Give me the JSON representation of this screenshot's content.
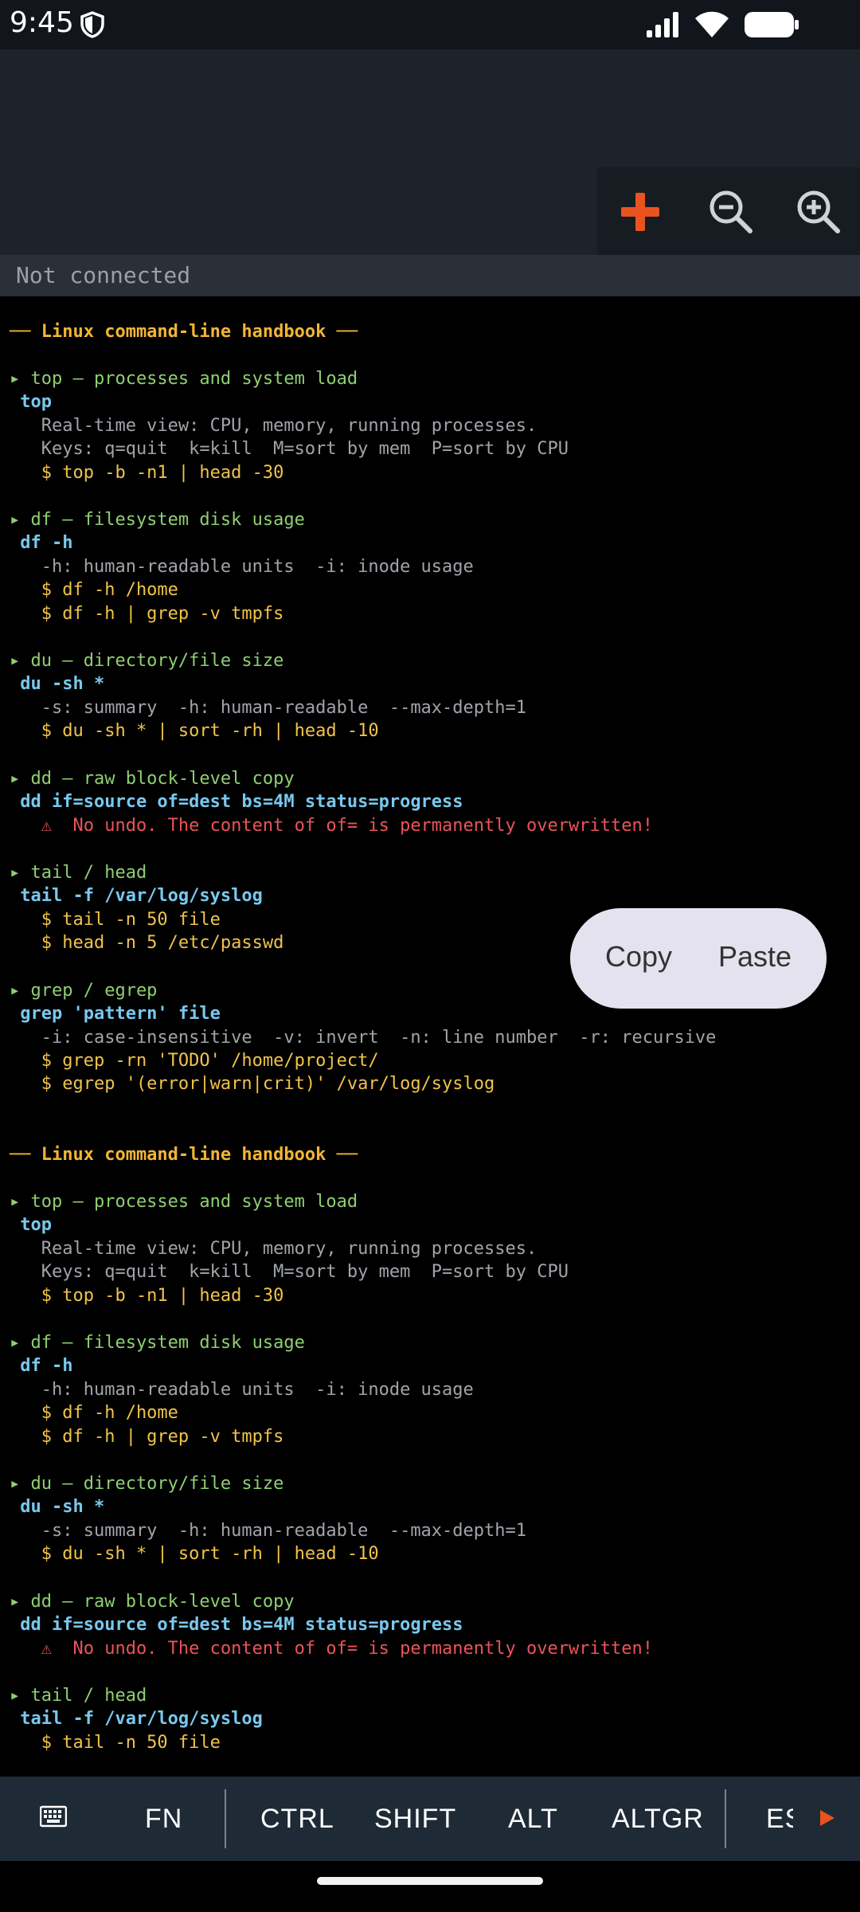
{
  "status": {
    "time": "9:45"
  },
  "connection": {
    "text": "Not connected"
  },
  "popup": {
    "copy": "Copy",
    "paste": "Paste"
  },
  "keys": [
    "FN",
    "CTRL",
    "SHIFT",
    "ALT",
    "ALTGR",
    "ES"
  ],
  "icons": {
    "shield": "shield-icon",
    "signal": "signal-icon",
    "wifi": "wifi-icon",
    "battery": "battery-icon",
    "more": "more-vert-icon",
    "add": "plus-icon",
    "zoom_out": "zoom-out-icon",
    "zoom_in": "zoom-in-icon",
    "keyboard": "keyboard-icon",
    "next": "play-arrow-icon"
  },
  "colors": {
    "accent": "#e8531f",
    "title": "#f2b534",
    "heading": "#8fcf72",
    "command": "#79c8ee",
    "example": "#f0c34a",
    "warning": "#e9545a"
  },
  "terminal": {
    "lines": [
      {
        "t": "── Linux command-line handbook ──",
        "c": "c-title"
      },
      {
        "t": "▸ top — processes and system load",
        "c": "c-head"
      },
      {
        "t": " top",
        "c": "c-cmd"
      },
      {
        "t": "   Real-time view: CPU, memory, running processes.",
        "c": "c-desc"
      },
      {
        "t": "   Keys: q=quit  k=kill  M=sort by mem  P=sort by CPU",
        "c": "c-desc"
      },
      {
        "t": "   $ top -b -n1 | head -30",
        "c": "c-ex"
      },
      {
        "t": "▸ df — filesystem disk usage",
        "c": "c-head"
      },
      {
        "t": " df -h",
        "c": "c-cmd"
      },
      {
        "t": "   -h: human-readable units  -i: inode usage",
        "c": "c-desc"
      },
      {
        "t": "   $ df -h /home",
        "c": "c-ex"
      },
      {
        "t": "   $ df -h | grep -v tmpfs",
        "c": "c-ex"
      },
      {
        "t": "▸ du — directory/file size",
        "c": "c-head"
      },
      {
        "t": " du -sh *",
        "c": "c-cmd"
      },
      {
        "t": "   -s: summary  -h: human-readable  --max-depth=1",
        "c": "c-desc"
      },
      {
        "t": "   $ du -sh * | sort -rh | head -10",
        "c": "c-ex"
      },
      {
        "t": "▸ dd — raw block-level copy",
        "c": "c-head"
      },
      {
        "t": " dd if=source of=dest bs=4M status=progress",
        "c": "c-cmd"
      },
      {
        "t": "   ⚠  No undo. The content of of= is permanently overwritten!",
        "c": "c-warn"
      },
      {
        "t": "▸ tail / head",
        "c": "c-head"
      },
      {
        "t": " tail -f /var/log/syslog",
        "c": "c-cmd"
      },
      {
        "t": "   $ tail -n 50 file",
        "c": "c-ex"
      },
      {
        "t": "   $ head -n 5 /etc/passwd",
        "c": "c-ex"
      },
      {
        "t": "▸ grep / egrep",
        "c": "c-head"
      },
      {
        "t": " grep 'pattern' file",
        "c": "c-cmd"
      },
      {
        "t": "   -i: case-insensitive  -v: invert  -n: line number  -r: recursive",
        "c": "c-desc"
      },
      {
        "t": "   $ grep -rn 'TODO' /home/project/",
        "c": "c-ex"
      },
      {
        "t": "   $ egrep '(error|warn|crit)' /var/log/syslog",
        "c": "c-ex"
      },
      {
        "t": "── Linux command-line handbook ──",
        "c": "c-title"
      },
      {
        "t": "▸ top — processes and system load",
        "c": "c-head"
      },
      {
        "t": " top",
        "c": "c-cmd"
      },
      {
        "t": "   Real-time view: CPU, memory, running processes.",
        "c": "c-desc"
      },
      {
        "t": "   Keys: q=quit  k=kill  M=sort by mem  P=sort by CPU",
        "c": "c-desc"
      },
      {
        "t": "   $ top -b -n1 | head -30",
        "c": "c-ex"
      },
      {
        "t": "▸ df — filesystem disk usage",
        "c": "c-head"
      },
      {
        "t": " df -h",
        "c": "c-cmd"
      },
      {
        "t": "   -h: human-readable units  -i: inode usage",
        "c": "c-desc"
      },
      {
        "t": "   $ df -h /home",
        "c": "c-ex"
      },
      {
        "t": "   $ df -h | grep -v tmpfs",
        "c": "c-ex"
      },
      {
        "t": "▸ du — directory/file size",
        "c": "c-head"
      },
      {
        "t": " du -sh *",
        "c": "c-cmd"
      },
      {
        "t": "   -s: summary  -h: human-readable  --max-depth=1",
        "c": "c-desc"
      },
      {
        "t": "   $ du -sh * | sort -rh | head -10",
        "c": "c-ex"
      },
      {
        "t": "▸ dd — raw block-level copy",
        "c": "c-head"
      },
      {
        "t": " dd if=source of=dest bs=4M status=progress",
        "c": "c-cmd"
      },
      {
        "t": "   ⚠  No undo. The content of of= is permanently overwritten!",
        "c": "c-warn"
      },
      {
        "t": "▸ tail / head",
        "c": "c-head"
      },
      {
        "t": " tail -f /var/log/syslog",
        "c": "c-cmd"
      },
      {
        "t": "   $ tail -n 50 file",
        "c": "c-ex"
      }
    ]
  }
}
